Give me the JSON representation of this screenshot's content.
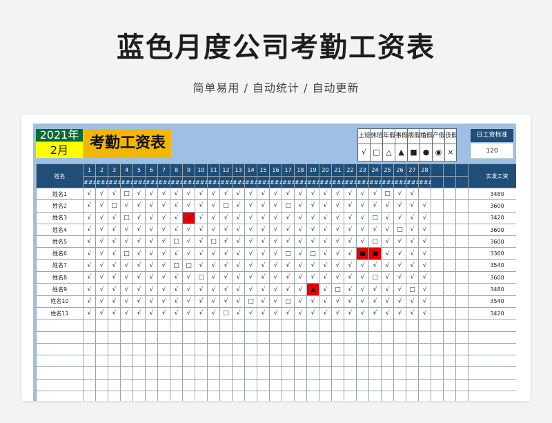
{
  "page": {
    "title": "蓝色月度公司考勤工资表",
    "subtitle": "简单易用 / 自动统计 / 自动更新"
  },
  "sheet": {
    "year": "2021年",
    "month": "2月",
    "title": "考勤工资表",
    "legend": [
      {
        "label": "上班",
        "symbol": "√"
      },
      {
        "label": "休班",
        "symbol": "□"
      },
      {
        "label": "年假",
        "symbol": "△"
      },
      {
        "label": "事假",
        "symbol": "▲"
      },
      {
        "label": "病假",
        "symbol": "■"
      },
      {
        "label": "婚假",
        "symbol": "●"
      },
      {
        "label": "产假",
        "symbol": "◉"
      },
      {
        "label": "丧假",
        "symbol": "×"
      }
    ],
    "daily_wage_label": "日工资标准",
    "daily_wage_value": "120",
    "name_header": "姓名",
    "wage_header": "实发工资",
    "days": [
      "1",
      "2",
      "3",
      "4",
      "5",
      "6",
      "7",
      "8",
      "9",
      "10",
      "11",
      "12",
      "13",
      "14",
      "15",
      "16",
      "17",
      "18",
      "19",
      "20",
      "21",
      "22",
      "23",
      "24",
      "25",
      "26",
      "27",
      "28"
    ],
    "weekday_placeholder": "###",
    "highlight_color": "#e60000",
    "rows": [
      {
        "name": "姓名1",
        "marks": "√√√□√√√√√√√√√√√√√√√√√√√√□√√",
        "wage": "3480"
      },
      {
        "name": "姓名2",
        "marks": "√√□√√√√√√√√□√√√√□√√√√√√√√√√√",
        "wage": "3600"
      },
      {
        "name": "姓名3",
        "marks": "√√√□√√√√△√√√√√√√√√√√√√√□√√√√",
        "wage": "3420"
      },
      {
        "name": "姓名4",
        "marks": "√√√√√√√√√√√√√√√√√√√√√√√√√□√√",
        "wage": "3600"
      },
      {
        "name": "姓名5",
        "marks": "√√√√√√√□√√□√√√√√√√√√√√√□√√√√",
        "wage": "3600"
      },
      {
        "name": "姓名6",
        "marks": "√√√□√√√√√√√√√√√√□√□√√√■■√√√√",
        "wage": "3360"
      },
      {
        "name": "姓名7",
        "marks": "√√√√√√√□□√√√√√√√√√√√√√√√√√√√",
        "wage": "3540"
      },
      {
        "name": "姓名8",
        "marks": "√√√√√√√√√□√√√√√√√√√√√√√□√√√√",
        "wage": "3600"
      },
      {
        "name": "姓名9",
        "marks": "√√√√√√√√√√√√√√√√√√▲√□√√√√√□√",
        "wage": "3480"
      },
      {
        "name": "姓名10",
        "marks": "√√√√√√√√√√√√√□√√□√√√√√√√√√√√",
        "wage": "3540"
      },
      {
        "name": "姓名11",
        "marks": "√√√√√√√√√√√□√√√√√√√√√√√√√√√√",
        "wage": "3420"
      }
    ],
    "empty_rows": 7
  }
}
